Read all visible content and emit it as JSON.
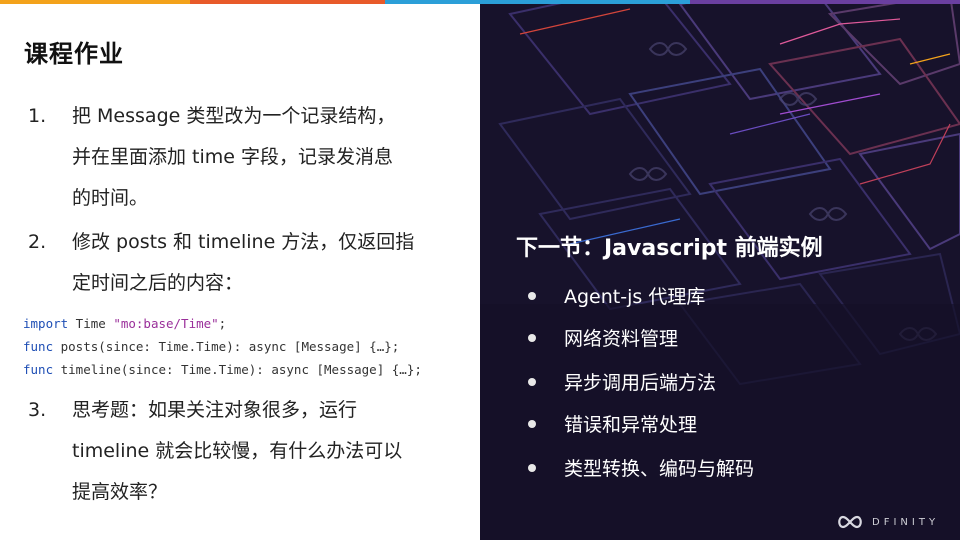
{
  "colors": {
    "topbar": [
      "#f3a21b",
      "#e85a2a",
      "#2b9fd8",
      "#6a3fa0"
    ],
    "right_bg": "#17122b",
    "keyword": "#1f4fb5",
    "string": "#9a2f9a"
  },
  "homework": {
    "title": "课程作业",
    "items": [
      {
        "num": "1.",
        "lines": [
          "把 Message 类型改为一个记录结构，",
          "并在里面添加 time 字段，记录发消息",
          "的时间。"
        ]
      },
      {
        "num": "2.",
        "lines": [
          "修改 posts 和 timeline 方法，仅返回指",
          "定时间之后的内容："
        ]
      },
      {
        "num": "3.",
        "lines": [
          "思考题：如果关注对象很多，运行",
          "timeline 就会比较慢，有什么办法可以",
          "提高效率？"
        ]
      }
    ],
    "code": [
      {
        "kw": "import",
        "rest": " Time ",
        "str": "\"mo:base/Time\"",
        "tail": ";"
      },
      {
        "kw": "func",
        "rest": " posts(since: Time.Time): async [Message] {…};",
        "str": "",
        "tail": ""
      },
      {
        "kw": "func",
        "rest": " timeline(since: Time.Time): async [Message] {…};",
        "str": "",
        "tail": ""
      }
    ]
  },
  "next": {
    "title": "下一节：Javascript 前端实例",
    "items": [
      "Agent-js 代理库",
      "网络资料管理",
      "异步调用后端方法",
      "错误和异常处理",
      "类型转换、编码与解码"
    ]
  },
  "logo": {
    "icon": "infinity-icon",
    "text": "DFINITY"
  }
}
